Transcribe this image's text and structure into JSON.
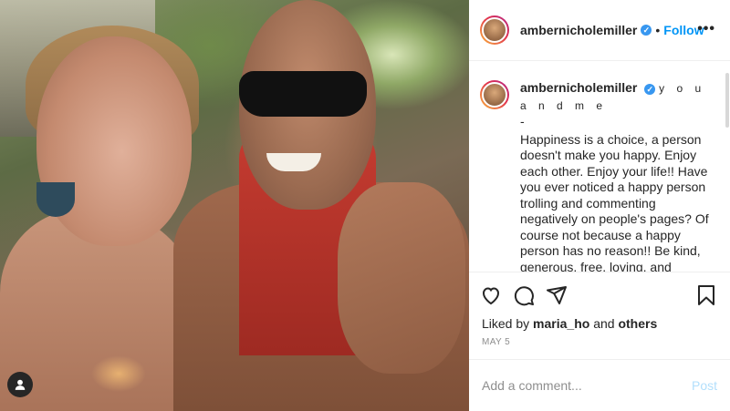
{
  "post": {
    "username": "ambernicholemiller",
    "follow_label": "Follow",
    "dot": "•",
    "more_label": "•••"
  },
  "caption": {
    "username": "ambernicholemiller",
    "spaced_title": "y o u a n d m e",
    "dash": "-",
    "text": "Happiness is a choice, a person doesn't make you happy. Enjoy each other. Enjoy your life!! Have you ever noticed a happy person trolling and commenting negatively on people's pages? Of course not because a happy person has no reason!! Be kind, generous, free, loving, and appreciate the people in your life. \"love\""
  },
  "likes": {
    "prefix": "Liked by",
    "user": "maria_ho",
    "and": "and",
    "others": "others"
  },
  "date": "MAY 5",
  "comment_box": {
    "placeholder": "Add a comment...",
    "post_label": "Post"
  },
  "colors": {
    "accent": "#0095f6",
    "verified": "#3897f0",
    "post_disabled": "#b2dffc"
  },
  "icons": {
    "like": "heart-icon",
    "comment": "comment-icon",
    "share": "paper-plane-icon",
    "save": "bookmark-icon",
    "verified": "verified-badge-icon",
    "tagged": "user-tag-icon"
  }
}
